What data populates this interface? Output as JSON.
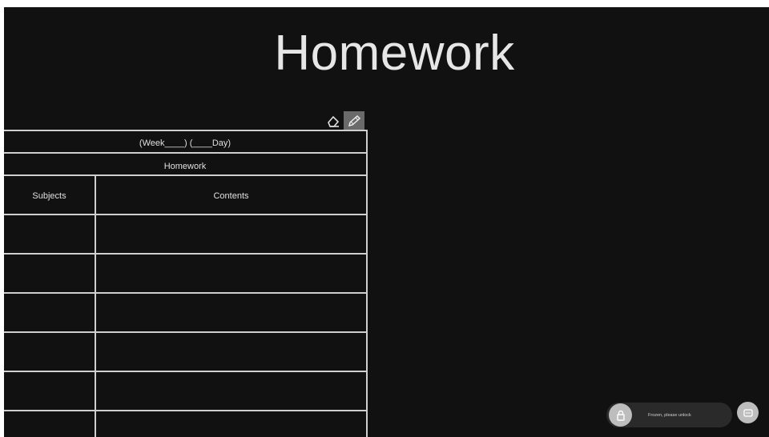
{
  "title": "Homework",
  "toolbar": {
    "eraser_icon": "eraser-icon",
    "pen_icon": "pen-icon"
  },
  "table": {
    "week_day_row": "(Week____)   (____Day)",
    "heading_row": "Homework",
    "columns": [
      "Subjects",
      "Contents"
    ],
    "empty_rows": 6
  },
  "unlock": {
    "lock_icon": "lock-icon",
    "message": "Frozen, please unlock",
    "action_icon": "screen-icon"
  },
  "colors": {
    "background": "#111111",
    "lines": "#cfcfcf",
    "text": "#e6e6e6"
  }
}
